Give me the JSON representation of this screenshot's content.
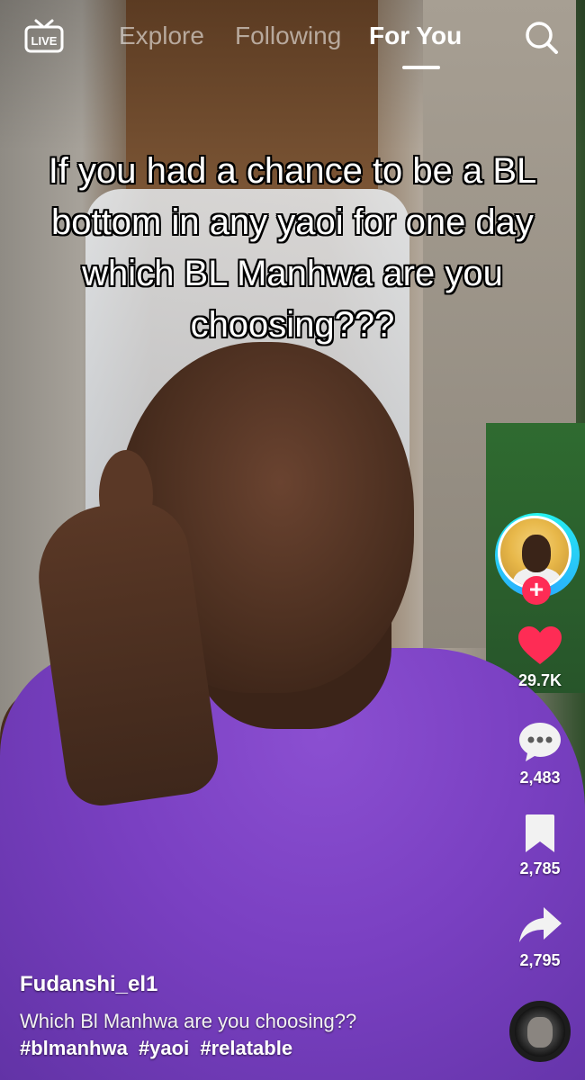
{
  "topnav": {
    "live_label": "LIVE",
    "tabs": [
      {
        "label": "Explore",
        "active": false
      },
      {
        "label": "Following",
        "active": false
      },
      {
        "label": "For You",
        "active": true
      }
    ]
  },
  "video": {
    "overlay_text": "If you had a chance to be a BL bottom in any yaoi for one day which BL Manhwa are you choosing???"
  },
  "actions": {
    "follow_symbol": "+",
    "likes": "29.7K",
    "comments": "2,483",
    "saves": "2,785",
    "shares": "2,795"
  },
  "post": {
    "username": "Fudanshi_el1",
    "description": "Which Bl Manhwa are you choosing??",
    "hashtags": [
      "#blmanhwa",
      "#yaoi",
      "#relatable"
    ]
  },
  "colors": {
    "like": "#fe2c55",
    "follow": "#fe2c55",
    "avatar_ring": "#25f4ee"
  },
  "icons": [
    "live-tv-icon",
    "search-icon",
    "heart-icon",
    "comment-icon",
    "bookmark-icon",
    "share-icon",
    "plus-icon",
    "music-disc-icon"
  ]
}
